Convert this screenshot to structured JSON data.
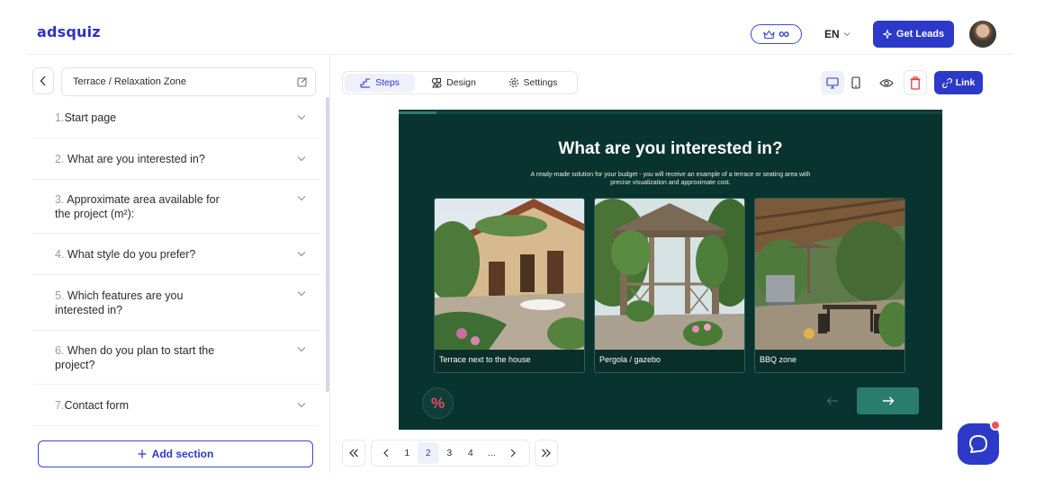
{
  "app": {
    "logo": "adsquiz",
    "plan_value": "∞",
    "language": "EN",
    "get_leads_label": "Get Leads"
  },
  "sidebar": {
    "quiz_title": "Terrace / Relaxation Zone",
    "steps": [
      {
        "num": "1.",
        "label": "Start page"
      },
      {
        "num": "2.",
        "label": "What are you interested in?"
      },
      {
        "num": "3.",
        "label": "Approximate area available for the project (m²):"
      },
      {
        "num": "4.",
        "label": "What style do you prefer?"
      },
      {
        "num": "5.",
        "label": "Which features are you interested in?"
      },
      {
        "num": "6.",
        "label": "When do you plan to start the project?"
      },
      {
        "num": "7.",
        "label": "Contact form"
      }
    ],
    "add_section_label": "Add section"
  },
  "tabs": {
    "steps": "Steps",
    "design": "Design",
    "settings": "Settings",
    "active": "steps"
  },
  "toolbar": {
    "link_label": "Link"
  },
  "preview": {
    "progress_fraction": 0.07,
    "question_title": "What are you interested in?",
    "question_description": "A ready-made solution for your budget - you will receive an example of a terrace or seating area with precise visualization and approximate cost.",
    "options": [
      {
        "label": "Terrace next to the house"
      },
      {
        "label": "Pergola / gazebo"
      },
      {
        "label": "BBQ zone"
      }
    ],
    "promo_symbol": "%",
    "accent_color": "#2a7d6c",
    "background_color": "#08332e"
  },
  "pagination": {
    "pages": [
      "1",
      "2",
      "3",
      "4",
      "..."
    ],
    "active_page": "2"
  }
}
